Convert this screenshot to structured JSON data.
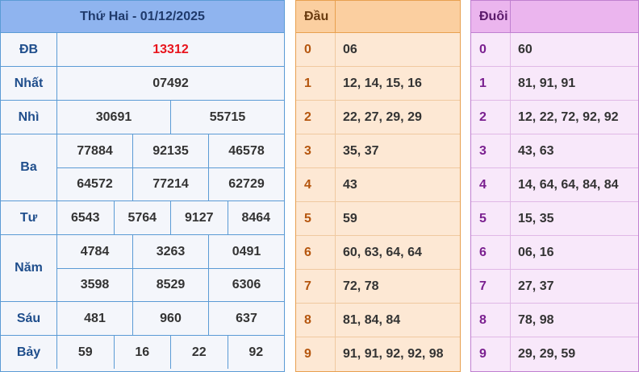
{
  "results": {
    "title": "Thứ Hai - 01/12/2025",
    "prizes": [
      {
        "name": "ĐB",
        "lines": [
          [
            "13312"
          ]
        ]
      },
      {
        "name": "Nhất",
        "lines": [
          [
            "07492"
          ]
        ]
      },
      {
        "name": "Nhì",
        "lines": [
          [
            "30691",
            "55715"
          ]
        ]
      },
      {
        "name": "Ba",
        "lines": [
          [
            "77884",
            "92135",
            "46578"
          ],
          [
            "64572",
            "77214",
            "62729"
          ]
        ]
      },
      {
        "name": "Tư",
        "lines": [
          [
            "6543",
            "5764",
            "9127",
            "8464"
          ]
        ]
      },
      {
        "name": "Năm",
        "lines": [
          [
            "4784",
            "3263",
            "0491"
          ],
          [
            "3598",
            "8529",
            "6306"
          ]
        ]
      },
      {
        "name": "Sáu",
        "lines": [
          [
            "481",
            "960",
            "637"
          ]
        ]
      },
      {
        "name": "Bảy",
        "lines": [
          [
            "59",
            "16",
            "22",
            "92"
          ]
        ]
      }
    ],
    "highlight_color": "#e8141c"
  },
  "dau": {
    "header": "Đầu",
    "rows": [
      {
        "key": "0",
        "values": "06"
      },
      {
        "key": "1",
        "values": "12, 14, 15, 16"
      },
      {
        "key": "2",
        "values": "22, 27, 29, 29"
      },
      {
        "key": "3",
        "values": "35, 37"
      },
      {
        "key": "4",
        "values": "43"
      },
      {
        "key": "5",
        "values": "59"
      },
      {
        "key": "6",
        "values": "60, 63, 64, 64"
      },
      {
        "key": "7",
        "values": "72, 78"
      },
      {
        "key": "8",
        "values": "81, 84, 84"
      },
      {
        "key": "9",
        "values": "91, 91, 92, 92, 98"
      }
    ]
  },
  "duoi": {
    "header": "Đuôi",
    "rows": [
      {
        "key": "0",
        "values": "60"
      },
      {
        "key": "1",
        "values": "81, 91, 91"
      },
      {
        "key": "2",
        "values": "12, 22, 72, 92, 92"
      },
      {
        "key": "3",
        "values": "43, 63"
      },
      {
        "key": "4",
        "values": "14, 64, 64, 84, 84"
      },
      {
        "key": "5",
        "values": "15, 35"
      },
      {
        "key": "6",
        "values": "06, 16"
      },
      {
        "key": "7",
        "values": "27, 37"
      },
      {
        "key": "8",
        "values": "78, 98"
      },
      {
        "key": "9",
        "values": "29, 29, 59"
      }
    ]
  },
  "colors": {
    "results_header": "#8fb4ef",
    "dau_header": "#fbcfa0",
    "duoi_header": "#ebb5ee"
  }
}
